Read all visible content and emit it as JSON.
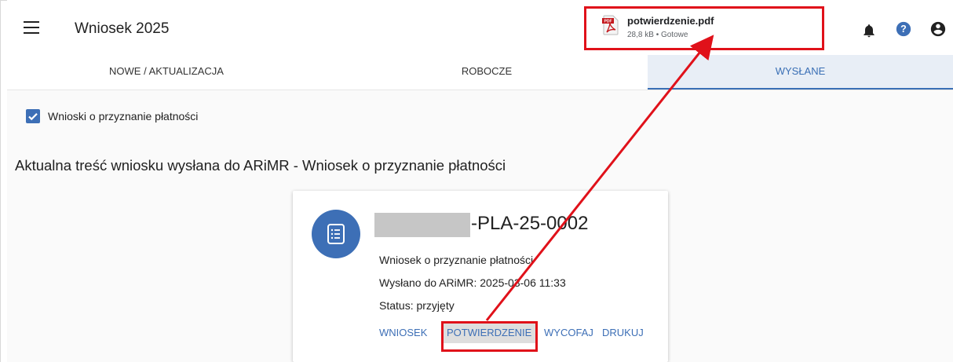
{
  "app": {
    "title": "Wniosek 2025"
  },
  "tabs": [
    {
      "label": "NOWE / AKTUALIZACJA",
      "active": false
    },
    {
      "label": "ROBOCZE",
      "active": false
    },
    {
      "label": "WYSŁANE",
      "active": true
    }
  ],
  "filter": {
    "label": "Wnioski o przyznanie płatności",
    "checked": true
  },
  "section": {
    "title": "Aktualna treść wniosku wysłana do ARiMR - Wniosek o przyznanie płatności"
  },
  "card": {
    "id_suffix": "-PLA-25-0002",
    "type": "Wniosek o przyznanie płatności",
    "sent": "Wysłano do ARiMR: 2025-03-06 11:33",
    "status": "Status: przyjęty",
    "buttons": [
      "WNIOSEK",
      "POTWIERDZENIE",
      "WYCOFAJ",
      "DRUKUJ"
    ]
  },
  "download": {
    "filename": "potwierdzenie.pdf",
    "meta": "28,8 kB • Gotowe"
  },
  "colors": {
    "accent": "#3d6fb6",
    "highlight": "#e0111a",
    "active_tab_bg": "#e8eef6"
  },
  "icons": [
    "menu-icon",
    "bell-icon",
    "help-icon",
    "account-icon",
    "document-list-icon",
    "pdf-file-icon",
    "checkbox-checked-icon"
  ]
}
